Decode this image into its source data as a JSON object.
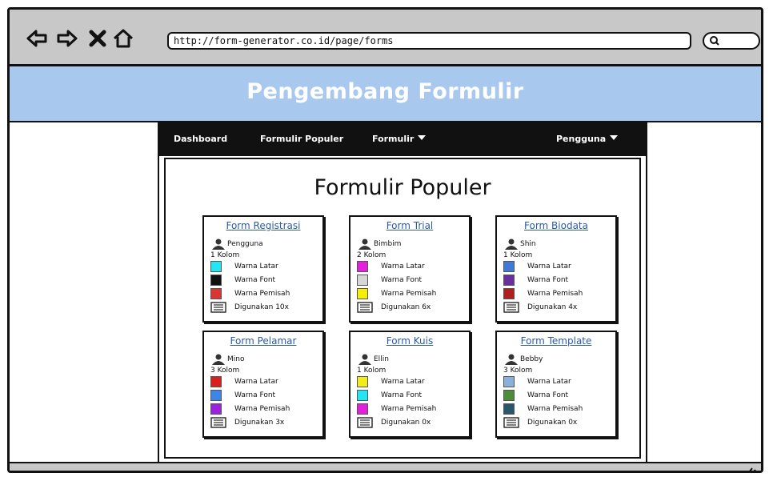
{
  "browser": {
    "url": "http://form-generator.co.id/page/forms",
    "icons": [
      "back-arrow-icon",
      "forward-arrow-icon",
      "close-x-icon",
      "home-icon",
      "search-icon"
    ]
  },
  "header": {
    "title": "Pengembang Formulir"
  },
  "nav": {
    "dashboard": "Dashboard",
    "popular": "Formulir Populer",
    "forms": "Formulir",
    "user": "Pengguna"
  },
  "main": {
    "title": "Formulir Populer",
    "labels": {
      "bg": "Warna Latar",
      "font": "Warna Font",
      "sep": "Warna Pemisah"
    },
    "forms": [
      {
        "title": "Form Registrasi",
        "owner": "Pengguna",
        "columns": "1 Kolom",
        "colors": [
          "#22e6f2",
          "#111111",
          "#d93535"
        ],
        "usage": "Digunakan 10x"
      },
      {
        "title": "Form Trial",
        "owner": "Bimbim",
        "columns": "2 Kolom",
        "colors": [
          "#e51ddc",
          "#d6d6d6",
          "#f5f000"
        ],
        "usage": "Digunakan 6x"
      },
      {
        "title": "Form Biodata",
        "owner": "Shin",
        "columns": "1 Kolom",
        "colors": [
          "#3f7ad6",
          "#6a2f9e",
          "#b01e1e"
        ],
        "usage": "Digunakan 4x"
      },
      {
        "title": "Form Pelamar",
        "owner": "Mino",
        "columns": "3 Kolom",
        "colors": [
          "#d91e1e",
          "#3d86e8",
          "#9d22e0"
        ],
        "usage": "Digunakan 3x"
      },
      {
        "title": "Form Kuis",
        "owner": "Ellin",
        "columns": "1 Kolom",
        "colors": [
          "#f2ec1a",
          "#22e6f2",
          "#e51ddc"
        ],
        "usage": "Digunakan 0x"
      },
      {
        "title": "Form Template",
        "owner": "Bebby",
        "columns": "3 Kolom",
        "colors": [
          "#8ab0dc",
          "#4d8c3a",
          "#28566a"
        ],
        "usage": "Digunakan 0x"
      }
    ]
  },
  "colors": {
    "header_bg": "#a9c8ee",
    "chrome_bg": "#c8c8c8",
    "nav_bg": "#111111",
    "link": "#2b5aa8"
  }
}
